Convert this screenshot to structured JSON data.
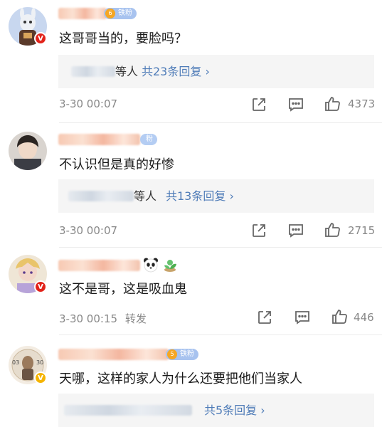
{
  "comments": [
    {
      "text": "这哥哥当的，要脸吗？",
      "fan_badge": "铁粉",
      "badge_level": "6",
      "verified": "V",
      "reply_who": "等人",
      "reply_total": "共23条回复 ›",
      "time": "3-30 00:07",
      "repost": "",
      "likes": "4373"
    },
    {
      "text": "不认识但是真的好惨",
      "fan_badge": "粉",
      "badge_level": "",
      "verified": "",
      "reply_who": "等人",
      "reply_total": "共13条回复 ›",
      "time": "3-30 00:07",
      "repost": "",
      "likes": "2715"
    },
    {
      "text": "这不是哥，这是吸血鬼",
      "fan_badge": "",
      "badge_level": "",
      "verified": "V",
      "reply_who": "",
      "reply_total": "",
      "time": "3-30 00:15",
      "repost": "转发",
      "likes": "446"
    },
    {
      "text": "天哪，这样的家人为什么还要把他们当家人",
      "fan_badge": "铁粉",
      "badge_level": "5",
      "verified": "V",
      "reply_who": "",
      "reply_total": "共5条回复 ›",
      "time": "",
      "repost": "",
      "likes": ""
    }
  ],
  "colors": {
    "link_blue": "#4f7cb8",
    "meta_gray": "#888888",
    "reply_bg": "#f5f5f5"
  },
  "icons": [
    "share-icon",
    "comment-icon",
    "like-icon",
    "panda-emoji",
    "plant-emoji"
  ]
}
